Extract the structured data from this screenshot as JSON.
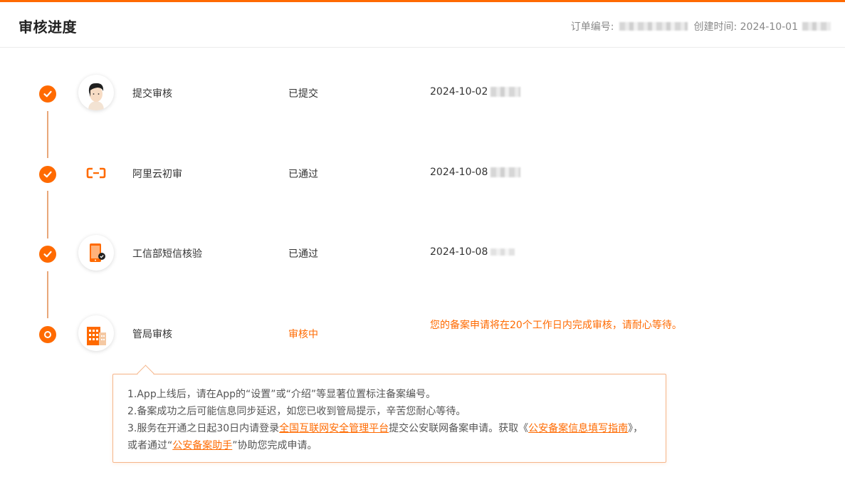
{
  "header": {
    "title": "审核进度",
    "order_label": "订单编号:",
    "created_label": "创建时间: 2024-10-01"
  },
  "steps": [
    {
      "label": "提交审核",
      "status": "已提交",
      "time": "2024-10-02",
      "icon": "person-avatar-icon"
    },
    {
      "label": "阿里云初审",
      "status": "已通过",
      "time": "2024-10-08",
      "icon": "aliyun-logo-icon"
    },
    {
      "label": "工信部短信核验",
      "status": "已通过",
      "time": "2024-10-08",
      "icon": "phone-verify-icon"
    },
    {
      "label": "管局审核",
      "status": "审核中",
      "note": "您的备案申请将在20个工作日内完成审核，请耐心等待。",
      "icon": "building-icon"
    }
  ],
  "tips": {
    "line1": "1.App上线后，请在App的“设置”或“介绍”等显著位置标注备案编号。",
    "line2": "2.备案成功之后可能信息同步延迟，如您已收到管局提示，辛苦您耐心等待。",
    "line3_a": "3.服务在开通之日起30日内请登录",
    "line3_link1": "全国互联网安全管理平台",
    "line3_b": "提交公安联网备案申请。获取《",
    "line3_link2": "公安备案信息填写指南",
    "line3_c": "》，或者通过“",
    "line3_link3": "公安备案助手",
    "line3_d": "”协助您完成申请。"
  },
  "colors": {
    "accent": "#ff6a00",
    "timeline": "#e8a77a",
    "tip_border": "#f5b58a"
  }
}
